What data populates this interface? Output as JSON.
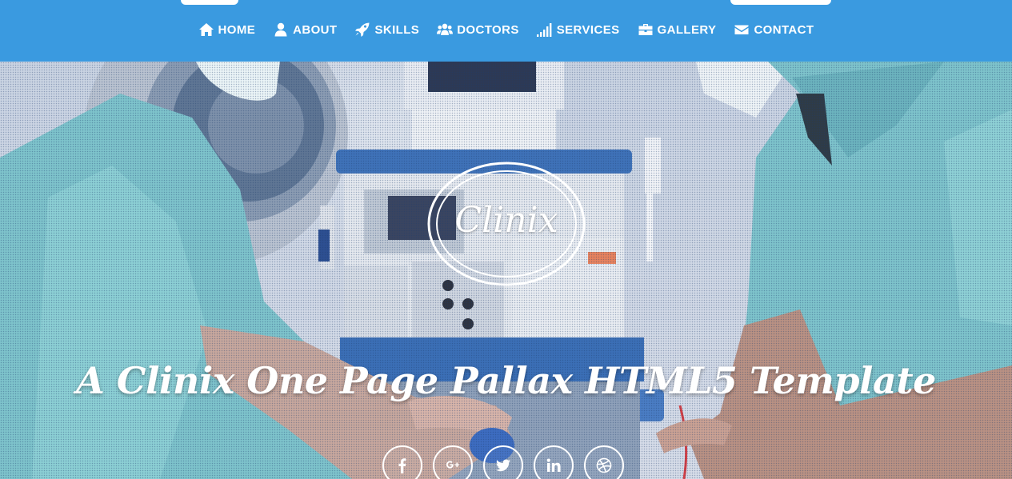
{
  "nav": {
    "items": [
      {
        "label": "HOME",
        "icon": "home-icon"
      },
      {
        "label": "ABOUT",
        "icon": "user-icon"
      },
      {
        "label": "SKILLS",
        "icon": "rocket-icon"
      },
      {
        "label": "DOCTORS",
        "icon": "users-icon"
      },
      {
        "label": "SERVICES",
        "icon": "signal-icon"
      },
      {
        "label": "GALLERY",
        "icon": "briefcase-icon"
      },
      {
        "label": "CONTACT",
        "icon": "envelope-icon"
      }
    ]
  },
  "hero": {
    "logo_text": "Clinix",
    "tagline": "A Clinix One Page Pallax HTML5 Template",
    "social": [
      {
        "icon": "facebook-icon"
      },
      {
        "icon": "google-plus-icon"
      },
      {
        "icon": "twitter-icon"
      },
      {
        "icon": "linkedin-icon"
      },
      {
        "icon": "dribbble-icon"
      }
    ]
  },
  "colors": {
    "nav_background": "#3a9ae0",
    "nav_text": "#ffffff",
    "scrubs": "#7ec3cb"
  }
}
